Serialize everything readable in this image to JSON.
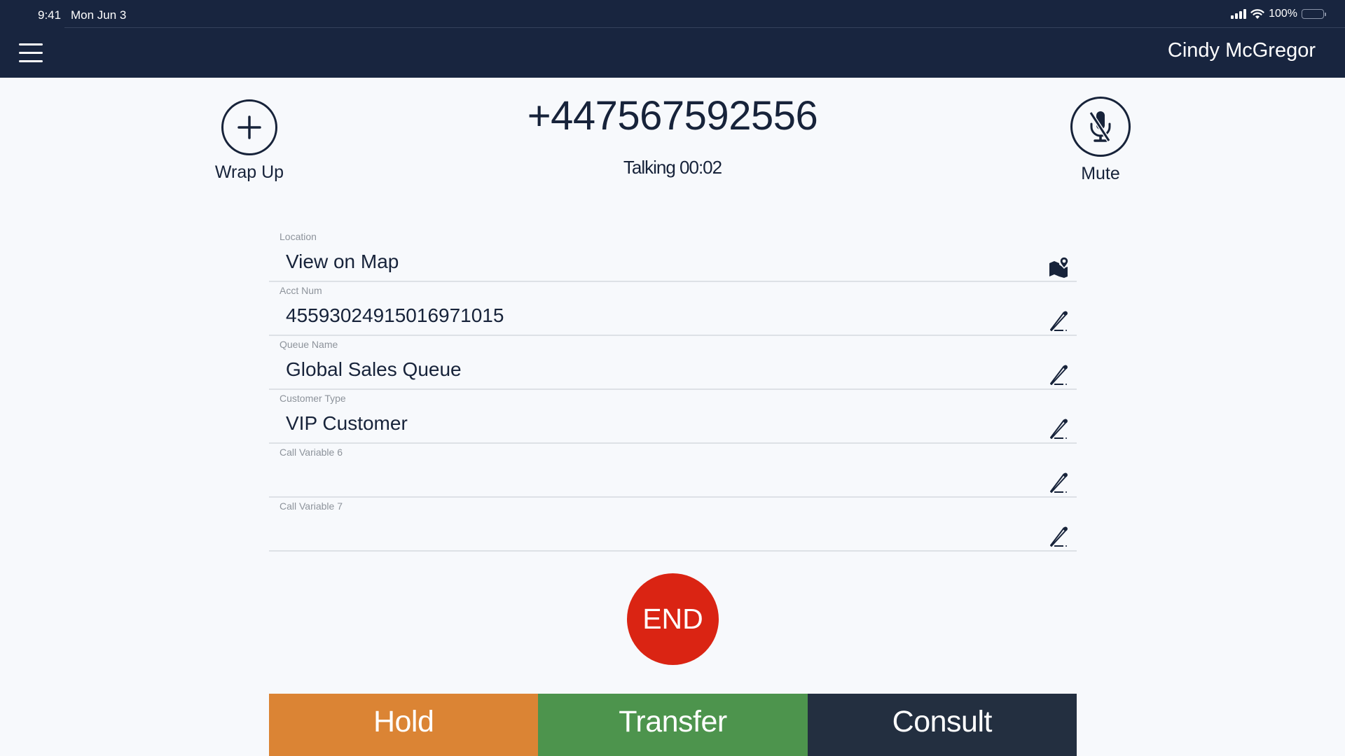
{
  "status_bar": {
    "time": "9:41",
    "date": "Mon Jun 3",
    "battery": "100%",
    "battery_level": 1.0,
    "signal_icon": "cellular-signal-icon",
    "wifi_icon": "wifi-icon"
  },
  "nav": {
    "menu_icon": "hamburger-menu-icon",
    "user_name": "Cindy McGregor"
  },
  "call": {
    "phone_number": "+447567592556",
    "status": "Talking 00:02"
  },
  "actions": {
    "wrap_up": {
      "label": "Wrap Up",
      "icon": "plus-circle-icon"
    },
    "mute": {
      "label": "Mute",
      "icon": "microphone-off-icon"
    }
  },
  "fields": [
    {
      "label": "Location",
      "value": "View on Map",
      "icon": "map-pin-icon"
    },
    {
      "label": "Acct Num",
      "value": "45593024915016971015",
      "icon": "pencil-icon"
    },
    {
      "label": "Queue Name",
      "value": "Global Sales Queue",
      "icon": "pencil-icon"
    },
    {
      "label": "Customer Type",
      "value": "VIP Customer",
      "icon": "pencil-icon"
    },
    {
      "label": "Call Variable 6",
      "value": "",
      "icon": "pencil-icon"
    },
    {
      "label": "Call Variable 7",
      "value": "",
      "icon": "pencil-icon"
    }
  ],
  "end_button": {
    "label": "END",
    "color": "#da2413"
  },
  "bottom_buttons": {
    "hold": {
      "label": "Hold",
      "color": "#db8434"
    },
    "transfer": {
      "label": "Transfer",
      "color": "#4d944d"
    },
    "consult": {
      "label": "Consult",
      "color": "#232f40"
    }
  },
  "colors": {
    "navy": "#18253f",
    "text": "#17233a",
    "background": "#f7f9fc"
  }
}
